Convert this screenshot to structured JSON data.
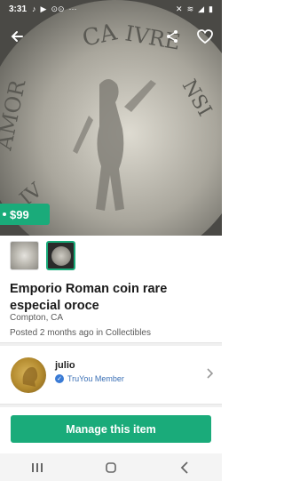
{
  "status_bar": {
    "time": "3:31",
    "left_icons": [
      "tiktok-icon",
      "youtube-icon",
      "voicemail-icon",
      "more-dots-icon"
    ],
    "right_icons": [
      "mute-icon",
      "wifi-icon",
      "signal-icon",
      "battery-icon"
    ]
  },
  "listing": {
    "price": "$99",
    "title": "Emporio Roman coin rare especial oroce",
    "location": "Compton, CA",
    "posted_prefix": "Posted 2 months ago in ",
    "category": "Collectibles",
    "thumbnails": [
      "thumbnail-1",
      "thumbnail-2"
    ]
  },
  "seller": {
    "name": "julio",
    "badge": "TruYou Member"
  },
  "actions": {
    "manage": "Manage this item"
  },
  "colors": {
    "accent": "#1aab7a",
    "badge": "#3a7bd5"
  }
}
